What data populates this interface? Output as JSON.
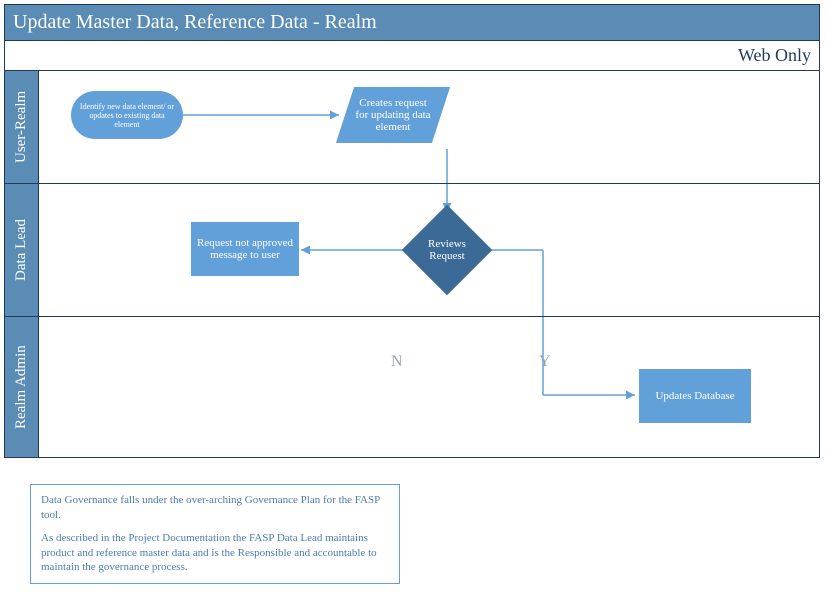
{
  "header": {
    "title": "Update Master Data, Reference Data - Realm",
    "subtitle": "Web Only"
  },
  "lanes": {
    "user_realm": {
      "label": "User-Realm"
    },
    "data_lead": {
      "label": "Data Lead"
    },
    "realm_admin": {
      "label": "Realm Admin"
    }
  },
  "nodes": {
    "identify": "Identify new data element/ or updates to existing data element",
    "create_request": "Creates request for updating data element",
    "not_approved": "Request not approved message to user",
    "reviews": "Reviews Request",
    "updates_db": "Updates Database"
  },
  "branches": {
    "no": "N",
    "yes": "Y"
  },
  "note": {
    "p1": "Data Governance falls under the over-arching Governance Plan for the FASP tool.",
    "p2": "As described in the Project Documentation the FASP Data Lead maintains product and reference master data and is the Responsible and accountable to maintain the governance process."
  }
}
